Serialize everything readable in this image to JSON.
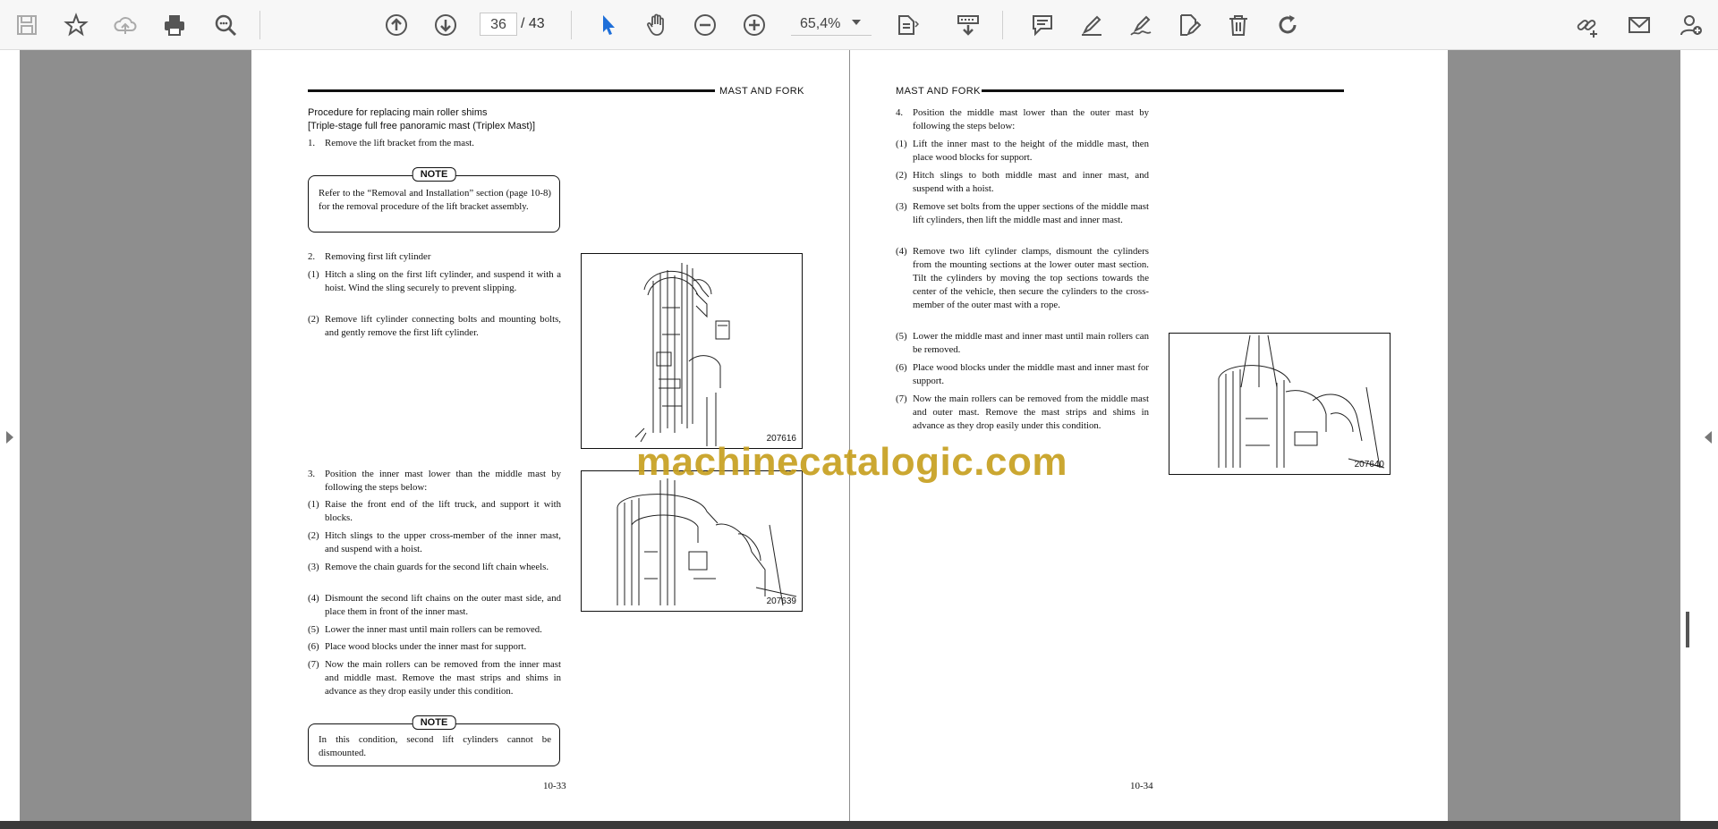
{
  "toolbar": {
    "icons": [
      "save-icon",
      "bookmark-star-icon",
      "cloud-upload-icon",
      "print-icon",
      "zoom-search-icon",
      "prev-page-icon",
      "next-page-icon",
      "select-cursor-icon",
      "hand-icon",
      "zoom-out-icon",
      "zoom-in-icon",
      "fit-page-icon",
      "read-mode-icon",
      "comment-icon",
      "highlight-icon",
      "sign-icon",
      "edit-text-icon",
      "delete-icon",
      "rotate-icon",
      "share-link-icon",
      "email-icon",
      "add-user-icon"
    ],
    "current_page": "36",
    "page_total": "/ 43",
    "zoom": "65,4%"
  },
  "left_page": {
    "header": "MAST AND FORK",
    "title1": "Procedure for replacing main roller shims",
    "title2": "[Triple-stage full free panoramic mast (Triplex Mast)]",
    "step1_num": "1.",
    "step1": "Remove the lift bracket from the mast.",
    "note_tag": "NOTE",
    "note1": "Refer to the “Removal and Installation” section (page 10-8) for the removal procedure of the lift bracket assembly.",
    "step2_num": "2.",
    "step2": "Removing first lift cylinder",
    "step2_items": [
      {
        "n": "(1)",
        "t": "Hitch a sling on the first lift cylinder, and suspend it with a hoist.  Wind the sling securely to prevent slipping."
      },
      {
        "n": "(2)",
        "t": "Remove lift cylinder connecting bolts and mounting bolts, and gently remove the first lift cylinder."
      }
    ],
    "fig1_label": "207616",
    "step3_num": "3.",
    "step3": "Position the inner mast lower than the middle mast by following the steps below:",
    "step3_items": [
      {
        "n": "(1)",
        "t": "Raise the front end of the lift truck, and support it with blocks."
      },
      {
        "n": "(2)",
        "t": "Hitch slings to the upper cross-member of the inner mast, and suspend with a hoist."
      },
      {
        "n": "(3)",
        "t": "Remove the chain guards for the second lift chain wheels."
      },
      {
        "n": "(4)",
        "t": "Dismount the second lift chains on the outer mast side, and place them in front of the inner mast."
      },
      {
        "n": "(5)",
        "t": "Lower the inner mast until main rollers can be removed."
      },
      {
        "n": "(6)",
        "t": "Place wood blocks under the inner mast for support."
      },
      {
        "n": "(7)",
        "t": "Now the main rollers can be removed from the inner mast and middle mast. Remove the mast strips and shims in advance as they drop easily under this condition."
      }
    ],
    "fig2_label": "207639",
    "note2": "In this condition, second lift cylinders cannot be dismounted.",
    "page_footer": "10-33"
  },
  "right_page": {
    "header": "MAST AND FORK",
    "step4_num": "4.",
    "step4": "Position the middle mast lower than the outer mast by following the steps below:",
    "step4_items": [
      {
        "n": "(1)",
        "t": "Lift the inner mast to the height of the middle mast, then place wood blocks for support."
      },
      {
        "n": "(2)",
        "t": "Hitch slings to both middle mast and inner mast, and suspend with a hoist."
      },
      {
        "n": "(3)",
        "t": "Remove set bolts from the upper sections of the middle mast lift cylinders, then lift the middle mast and inner mast."
      },
      {
        "n": "(4)",
        "t": "Remove two lift cylinder clamps, dismount the cylinders from the mounting sections at the lower outer mast section.  Tilt the cylinders by moving the top sections towards the center of the vehicle, then secure the cylinders to the cross-member of the outer mast with a rope."
      },
      {
        "n": "(5)",
        "t": "Lower the middle mast and inner mast until main rollers can be removed."
      },
      {
        "n": "(6)",
        "t": "Place wood blocks under the middle mast and inner mast for support."
      },
      {
        "n": "(7)",
        "t": "Now the main rollers can be removed from the middle mast and outer mast. Remove the mast strips and shims in advance as they drop easily under this condition."
      }
    ],
    "fig3_label": "207640",
    "page_footer": "10-34"
  },
  "watermark": "machinecatalogic.com"
}
